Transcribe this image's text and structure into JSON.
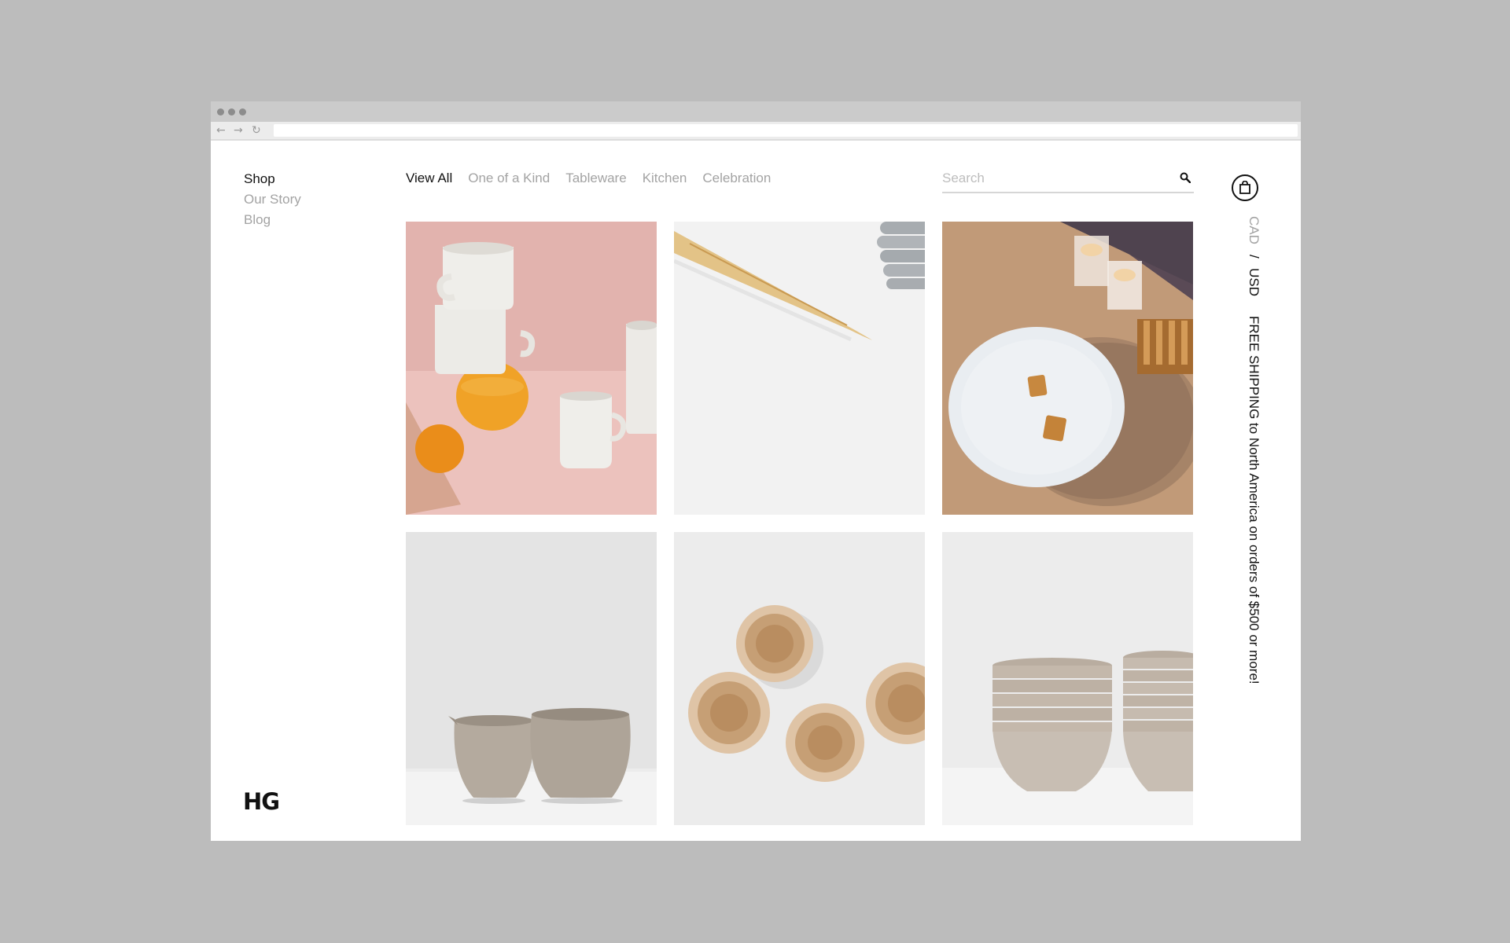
{
  "sidebar": {
    "items": [
      {
        "label": "Shop",
        "active": true
      },
      {
        "label": "Our Story",
        "active": false
      },
      {
        "label": "Blog",
        "active": false
      }
    ],
    "logo": "HG"
  },
  "categories": [
    {
      "label": "View All",
      "active": true
    },
    {
      "label": "One of a Kind",
      "active": false
    },
    {
      "label": "Tableware",
      "active": false
    },
    {
      "label": "Kitchen",
      "active": false
    },
    {
      "label": "Celebration",
      "active": false
    }
  ],
  "search": {
    "placeholder": "Search",
    "value": ""
  },
  "currency": {
    "cad": "CAD",
    "separator": "/",
    "usd": "USD",
    "selected": "USD"
  },
  "shipping_notice": "FREE SHIPPING to North America on orders of $500 or more!",
  "icons": [
    "search-icon",
    "shopping-bag-icon",
    "back-arrow-icon",
    "forward-arrow-icon",
    "reload-icon"
  ]
}
